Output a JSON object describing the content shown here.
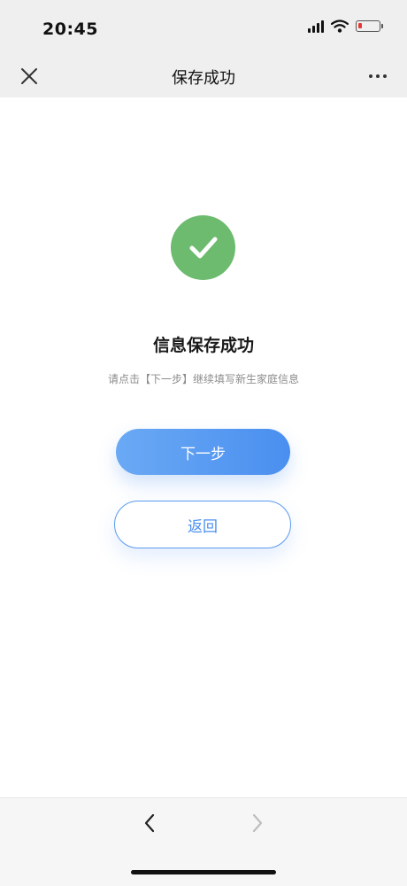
{
  "status_bar": {
    "time": "20:45",
    "icons": [
      "signal-icon",
      "wifi-icon",
      "battery-icon"
    ],
    "battery_color": "#e53935"
  },
  "nav": {
    "title": "保存成功",
    "left_icon": "close-icon",
    "right_icon": "more-icon"
  },
  "result": {
    "icon": "check-circle-icon",
    "icon_color": "#6cbb6e",
    "title": "信息保存成功",
    "subtitle": "请点击【下一步】继续填写新生家庭信息"
  },
  "actions": {
    "next_label": "下一步",
    "back_label": "返回",
    "primary_color": "#4a8ff0"
  },
  "browser_toolbar": {
    "back_icon": "chevron-left-icon",
    "forward_icon": "chevron-right-icon"
  }
}
